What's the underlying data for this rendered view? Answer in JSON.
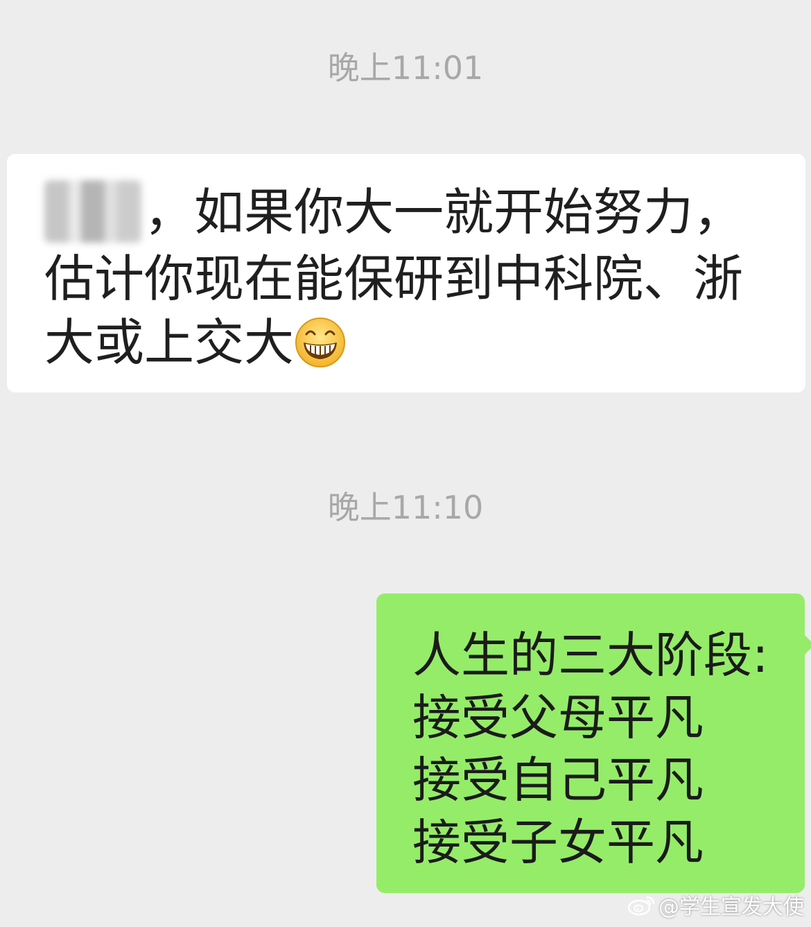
{
  "timestamps": {
    "first": "晚上11:01",
    "second": "晚上11:10"
  },
  "incoming_message": {
    "sender_name_redacted": true,
    "text": "，如果你大一就开始努力，估计你现在能保研到中科院、浙大或上交大",
    "emoji": "grinning-face"
  },
  "outgoing_message": {
    "lines": [
      "人生的三大阶段:",
      "接受父母平凡",
      "接受自己平凡",
      "接受子女平凡"
    ]
  },
  "watermark": {
    "text": "@学生宣发大使",
    "icon": "weibo-icon"
  },
  "colors": {
    "background": "#ededed",
    "incoming_bubble": "#ffffff",
    "outgoing_bubble": "#95ec69",
    "timestamp_text": "#a8a8a8"
  }
}
